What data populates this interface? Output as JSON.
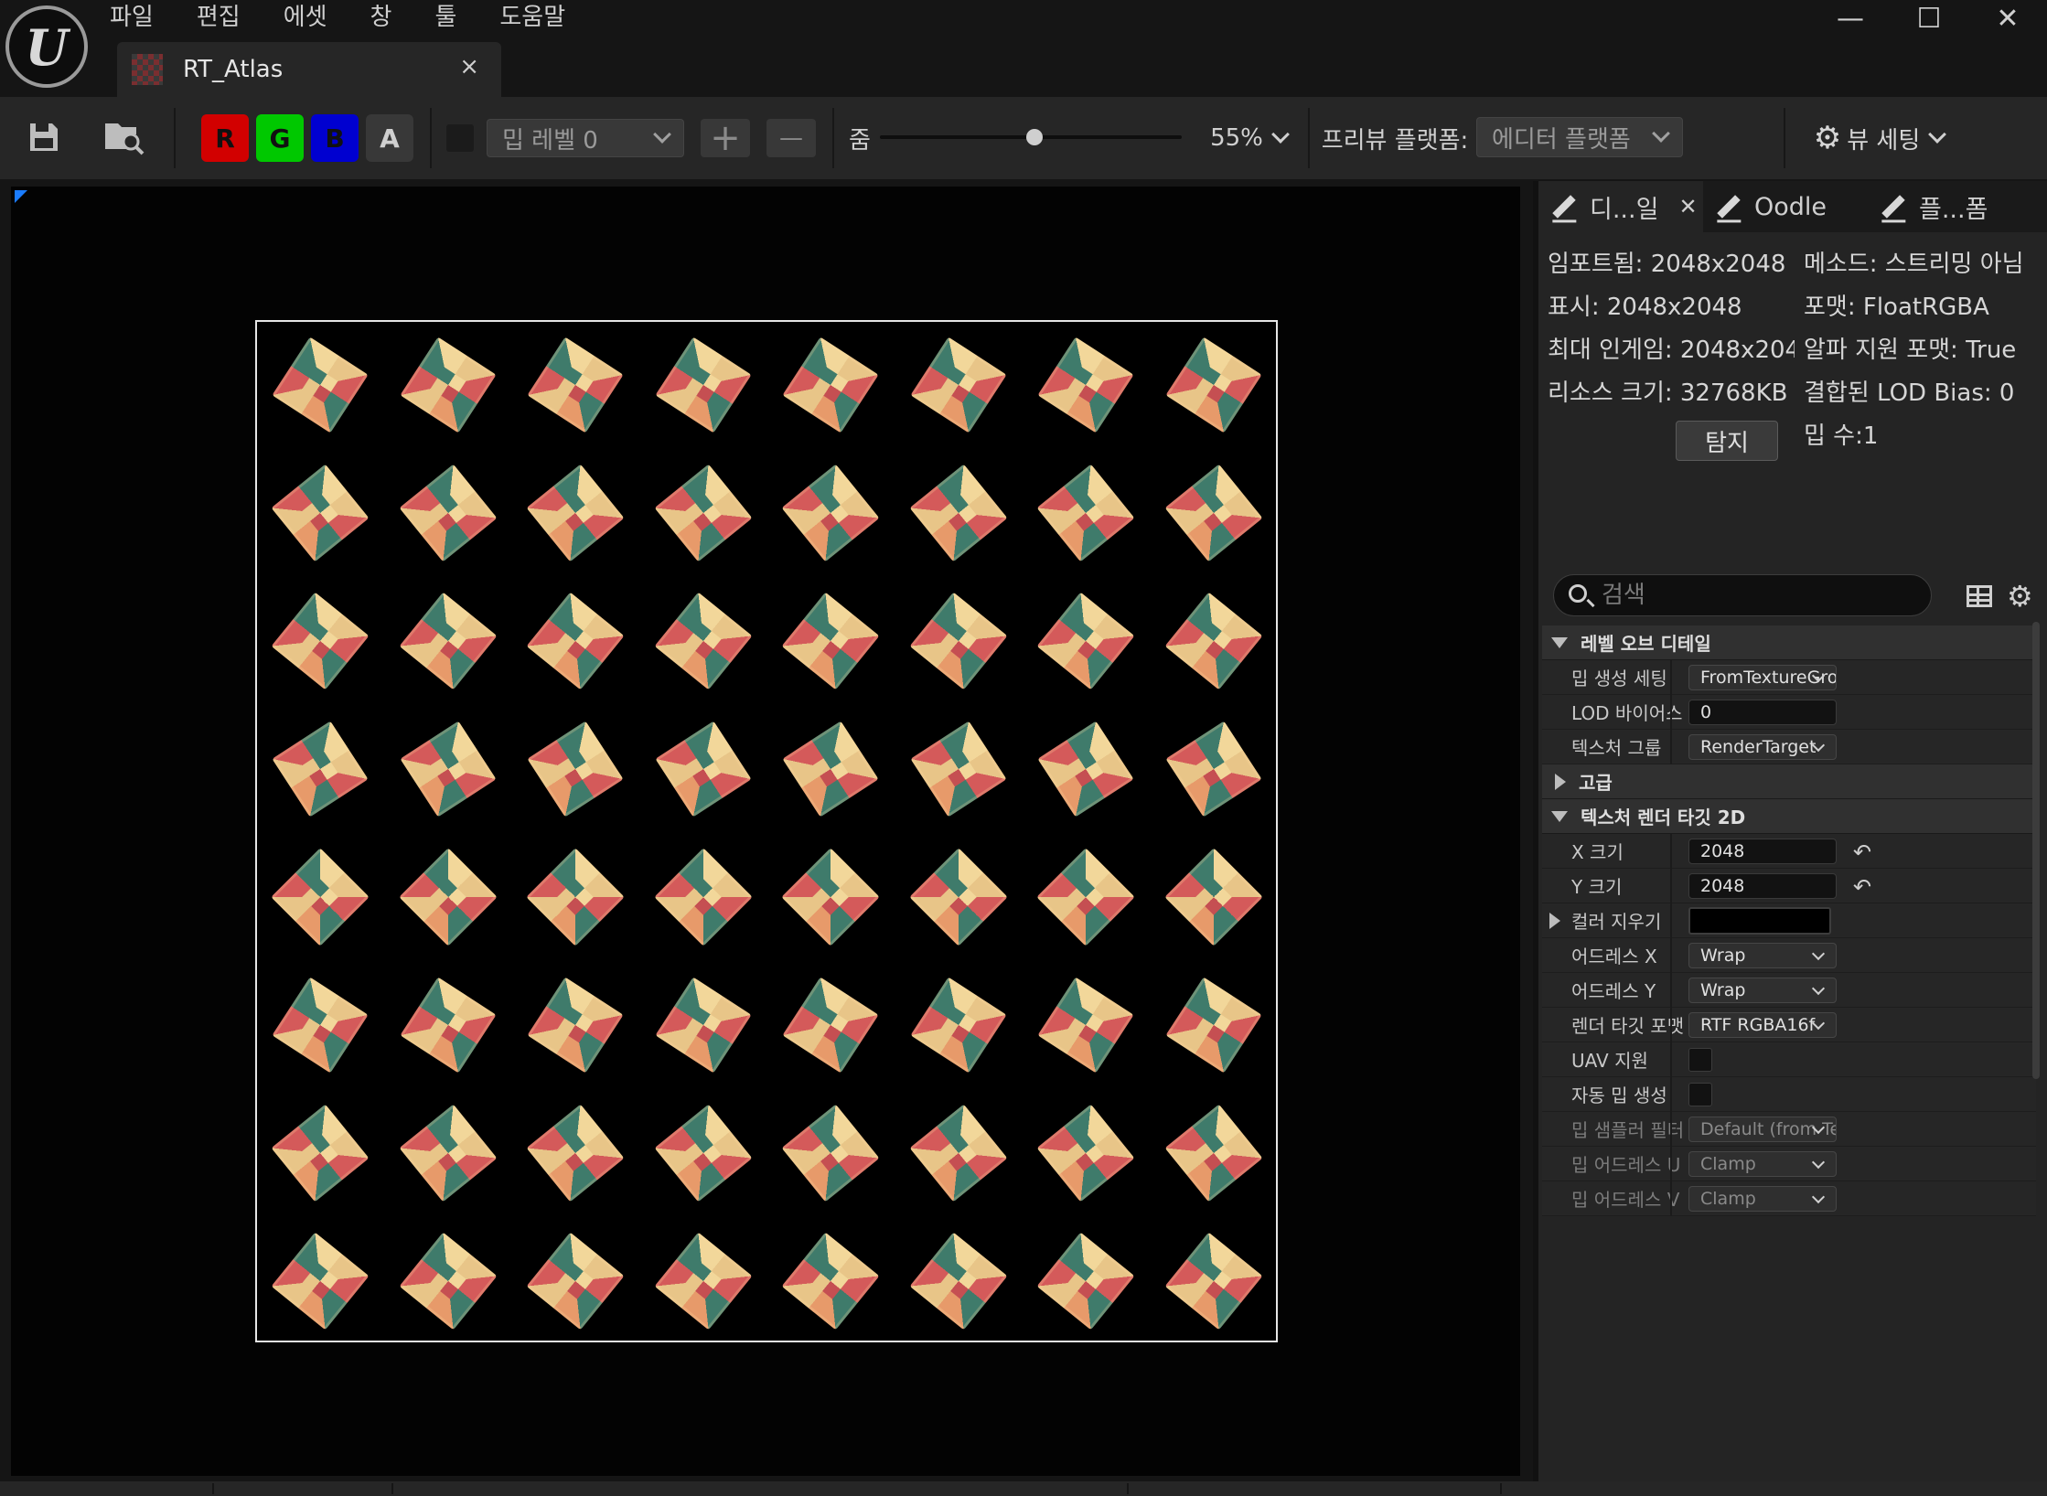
{
  "app": {
    "logo_text": "U",
    "menu": [
      "파일",
      "편집",
      "에셋",
      "창",
      "툴",
      "도움말"
    ],
    "window_controls": [
      "—",
      "☐",
      "✕"
    ]
  },
  "document_tab": {
    "title": "RT_Atlas",
    "close": "×"
  },
  "toolbar": {
    "channels": [
      {
        "label": "R",
        "color": "#d20000"
      },
      {
        "label": "G",
        "color": "#00c800"
      },
      {
        "label": "B",
        "color": "#0000d0"
      },
      {
        "label": "A",
        "color": "#383838"
      }
    ],
    "mip_level": "밉 레벨 0",
    "plus": "+",
    "minus": "—",
    "zoom_label": "줌",
    "zoom_value": "55%",
    "zoom_fraction": 0.55,
    "preview_platform_label": "프리뷰 플랫폼:",
    "preview_platform_value": "에디터 플랫폼",
    "view_settings": "뷰 세팅"
  },
  "viewport": {
    "atlas_grid_rows": 8,
    "atlas_grid_cols": 8
  },
  "panel": {
    "tabs": [
      {
        "label": "디...일",
        "active": true,
        "closable": true
      },
      {
        "label": "Oodle",
        "active": false,
        "closable": false
      },
      {
        "label": "플...폼",
        "active": false,
        "closable": false
      }
    ],
    "stats_left": [
      "임포트됨: 2048x2048",
      "표시: 2048x2048",
      "최대 인게임: 2048x204",
      "리소스 크기: 32768KB"
    ],
    "stats_right": [
      "메소드: 스트리밍 아님",
      "포맷: FloatRGBA",
      "알파 지원 포맷: True",
      "결합된 LOD Bias: 0",
      "밉 수:1"
    ],
    "probe_button": "탐지",
    "search_placeholder": "검색",
    "categories": {
      "level_of_detail": "레벨 오브 디테일",
      "advanced": "고급",
      "render_target": "텍스처 렌더 타깃 2D"
    },
    "lod_rows": [
      {
        "label": "밉 생성 세팅",
        "value": "FromTextureGrou",
        "kind": "combo"
      },
      {
        "label": "LOD 바이어스",
        "value": "0",
        "kind": "input"
      },
      {
        "label": "텍스처 그룹",
        "value": "RenderTarget",
        "kind": "combo"
      }
    ],
    "rt_rows": [
      {
        "label": "X 크기",
        "value": "2048",
        "kind": "input",
        "reset": true
      },
      {
        "label": "Y 크기",
        "value": "2048",
        "kind": "input",
        "reset": true
      },
      {
        "label": "컬러 지우기",
        "value": "",
        "kind": "color",
        "expandable": true
      },
      {
        "label": "어드레스 X",
        "value": "Wrap",
        "kind": "combo"
      },
      {
        "label": "어드레스 Y",
        "value": "Wrap",
        "kind": "combo"
      },
      {
        "label": "렌더 타깃 포맷",
        "value": "RTF RGBA16f",
        "kind": "combo"
      },
      {
        "label": "UAV 지원",
        "value": "",
        "kind": "check"
      },
      {
        "label": "자동 밉 생성",
        "value": "",
        "kind": "check"
      },
      {
        "label": "밉 샘플러 필터",
        "value": "Default (from Tex",
        "kind": "combo",
        "disabled": true
      },
      {
        "label": "밉 어드레스 U",
        "value": "Clamp",
        "kind": "combo",
        "disabled": true
      },
      {
        "label": "밉 어드레스 V",
        "value": "Clamp",
        "kind": "combo",
        "disabled": true
      }
    ],
    "reset_glyph": "↶"
  }
}
